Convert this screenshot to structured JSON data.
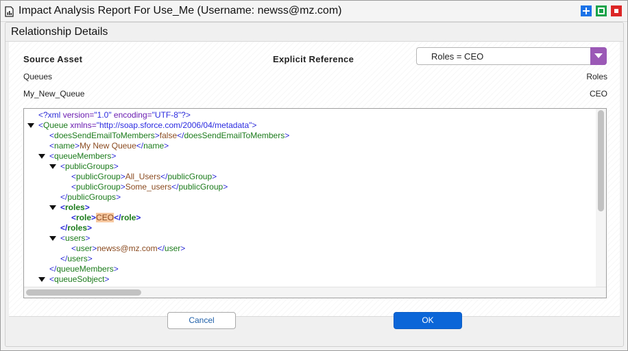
{
  "window": {
    "title": "Impact Analysis Report For Use_Me (Username: newss@mz.com)",
    "colors": {
      "blue": "#1a73e8",
      "green": "#16a34a",
      "red": "#dc2626"
    }
  },
  "panel": {
    "title": "Relationship Details"
  },
  "columns": {
    "source_asset": "Source Asset",
    "explicit_reference": "Explicit Reference"
  },
  "relationship": {
    "source_type": "Queues",
    "target_type": "Roles",
    "source_name": "My_New_Queue",
    "target_name": "CEO"
  },
  "dropdown": {
    "selected": "Roles = CEO",
    "icon": "chevron-down-icon",
    "accent": "#9b59b6"
  },
  "xml": {
    "decl": {
      "prefix": "<?xml ",
      "a1": "version=",
      "v1": "\"1.0\"",
      "a2": " encoding=",
      "v2": "\"UTF-8\"",
      "suffix": "?>"
    },
    "queue_open": {
      "name": "Queue",
      "attr": " xmlns=",
      "val": "\"http://soap.sforce.com/2006/04/metadata\""
    },
    "elements": {
      "doesSendEmailToMembers": "doesSendEmailToMembers",
      "name": "name",
      "queueMembers": "queueMembers",
      "publicGroups": "publicGroups",
      "publicGroup": "publicGroup",
      "roles": "roles",
      "role": "role",
      "users": "users",
      "user": "user",
      "queueSobject": "queueSobject"
    },
    "values": {
      "doesSendEmailToMembers": "false",
      "name": "My New Queue",
      "group1": "All_Users",
      "group2": "Some_users",
      "role": "CEO",
      "user": "newss@mz.com"
    }
  },
  "buttons": {
    "cancel": "Cancel",
    "ok": "OK",
    "ok_color": "#0b66d8"
  }
}
